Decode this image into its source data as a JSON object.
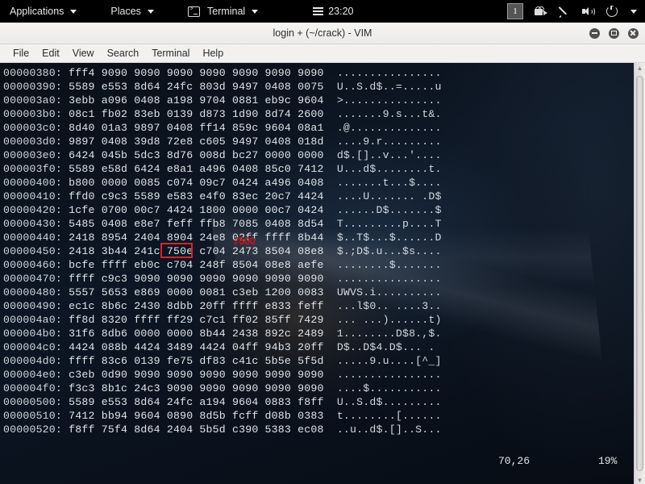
{
  "panel": {
    "menus": [
      {
        "label": "Applications",
        "icon": "none",
        "caret": true
      },
      {
        "label": "Places",
        "icon": "none",
        "caret": true
      },
      {
        "label": "Terminal",
        "icon": "terminal-icon",
        "caret": true
      }
    ],
    "clock": "23:20",
    "workspace": "1",
    "tray": [
      "camera-icon",
      "pen-icon",
      "volume-icon",
      "power-icon",
      "caret-down-icon"
    ]
  },
  "window": {
    "title": "login + (~/crack) - VIM",
    "buttons": {
      "minimize": "minimize-icon",
      "maximize": "maximize-icon",
      "close": "close-icon"
    },
    "menubar": [
      "File",
      "Edit",
      "View",
      "Search",
      "Terminal",
      "Help"
    ]
  },
  "terminal": {
    "lines": [
      {
        "offset": "00000380:",
        "hex": "fff4 9090 9090 9090 9090 9090 9090 9090",
        "ascii": "................"
      },
      {
        "offset": "00000390:",
        "hex": "5589 e553 8d64 24fc 803d 9497 0408 0075",
        "ascii": "U..S.d$..=.....u"
      },
      {
        "offset": "000003a0:",
        "hex": "3ebb a096 0408 a198 9704 0881 eb9c 9604",
        "ascii": ">..............."
      },
      {
        "offset": "000003b0:",
        "hex": "08c1 fb02 83eb 0139 d873 1d90 8d74 2600",
        "ascii": ".......9.s...t&."
      },
      {
        "offset": "000003c0:",
        "hex": "8d40 01a3 9897 0408 ff14 859c 9604 08a1",
        "ascii": ".@.............."
      },
      {
        "offset": "000003d0:",
        "hex": "9897 0408 39d8 72e8 c605 9497 0408 018d",
        "ascii": "....9.r........."
      },
      {
        "offset": "000003e0:",
        "hex": "6424 045b 5dc3 8d76 008d bc27 0000 0000",
        "ascii": "d$.[]..v...'...."
      },
      {
        "offset": "000003f0:",
        "hex": "5589 e58d 6424 e8a1 a496 0408 85c0 7412",
        "ascii": "U...d$........t."
      },
      {
        "offset": "00000400:",
        "hex": "b800 0000 0085 c074 09c7 0424 a496 0408",
        "ascii": ".......t...$...."
      },
      {
        "offset": "00000410:",
        "hex": "ffd0 c9c3 5589 e583 e4f0 83ec 20c7 4424",
        "ascii": "....U....... .D$"
      },
      {
        "offset": "00000420:",
        "hex": "1cfe 0700 00c7 4424 1800 0000 00c7 0424",
        "ascii": "......D$.......$"
      },
      {
        "offset": "00000430:",
        "hex": "5485 0408 e8e7 feff ffb8 7085 0408 8d54",
        "ascii": "T.........p....T"
      },
      {
        "offset": "00000440:",
        "hex": "2418 8954 2404 8904 24e8 02ff ffff 8b44",
        "ascii": "$..T$...$......D"
      },
      {
        "offset": "00000450:",
        "hex": "2418 3b44 241c 750e c704 2473 8504 08e8",
        "ascii": "$.;D$.u...$s...."
      },
      {
        "offset": "00000460:",
        "hex": "bcfe ffff eb0c c704 248f 8504 08e8 aefe",
        "ascii": "........$......."
      },
      {
        "offset": "00000470:",
        "hex": "ffff c9c3 9090 9090 9090 9090 9090 9090",
        "ascii": "................"
      },
      {
        "offset": "00000480:",
        "hex": "5557 5653 e869 0000 0081 c3eb 1200 0083",
        "ascii": "UWVS.i.........."
      },
      {
        "offset": "00000490:",
        "hex": "ec1c 8b6c 2430 8dbb 20ff ffff e833 feff",
        "ascii": "...l$0.. ....3.."
      },
      {
        "offset": "000004a0:",
        "hex": "ff8d 8320 ffff ff29 c7c1 ff02 85ff 7429",
        "ascii": "... ...)......t)"
      },
      {
        "offset": "000004b0:",
        "hex": "31f6 8db6 0000 0000 8b44 2438 892c 2489",
        "ascii": "1........D$8.,$."
      },
      {
        "offset": "000004c0:",
        "hex": "4424 088b 4424 3489 4424 04ff 94b3 20ff",
        "ascii": "D$..D$4.D$... ."
      },
      {
        "offset": "000004d0:",
        "hex": "ffff 83c6 0139 fe75 df83 c41c 5b5e 5f5d",
        "ascii": ".....9.u....[^_]"
      },
      {
        "offset": "000004e0:",
        "hex": "c3eb 0d90 9090 9090 9090 9090 9090 9090",
        "ascii": "................"
      },
      {
        "offset": "000004f0:",
        "hex": "f3c3 8b1c 24c3 9090 9090 9090 9090 9090",
        "ascii": "....$..........."
      },
      {
        "offset": "00000500:",
        "hex": "5589 e553 8d64 24fc a194 9604 0883 f8ff",
        "ascii": "U..S.d$........."
      },
      {
        "offset": "00000510:",
        "hex": "7412 bb94 9604 0890 8d5b fcff d08b 0383",
        "ascii": "t........[......"
      },
      {
        "offset": "00000520:",
        "hex": "f8ff 75f4 8d64 2404 5b5d c390 5383 ec08",
        "ascii": "..u..d$.[]..S..."
      }
    ],
    "annotation": {
      "highlighted_value": "750e",
      "label": "7500",
      "color": "#e02020"
    },
    "status": {
      "position": "70,26",
      "percent": "19%"
    }
  },
  "scrollbar": {
    "up_arrow": "chevron-up-icon",
    "down_arrow": "chevron-down-icon"
  }
}
